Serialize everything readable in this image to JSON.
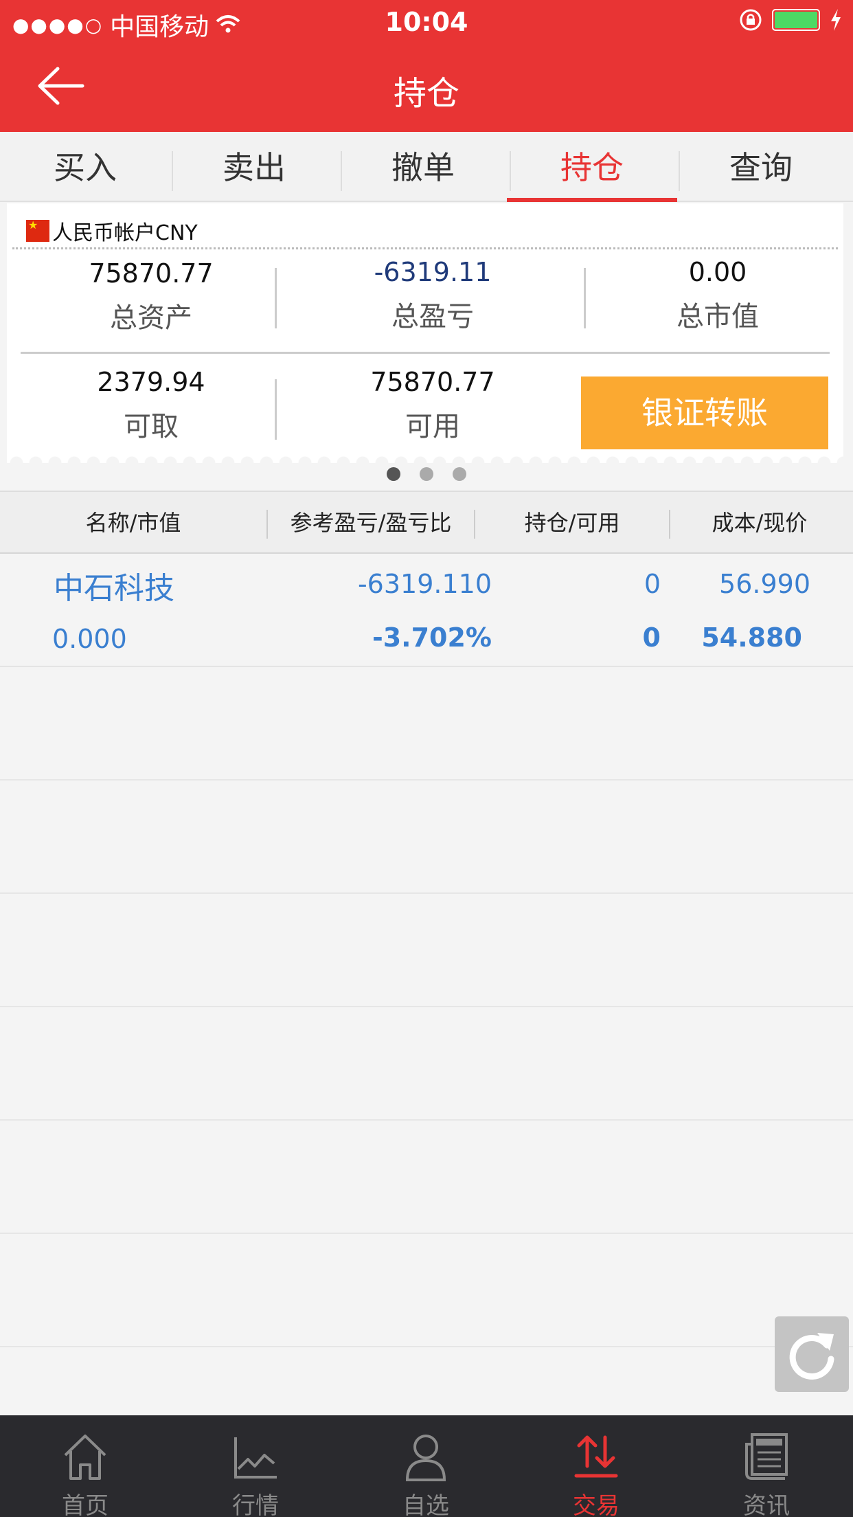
{
  "status_bar": {
    "signal": "●●●●○",
    "carrier": "中国移动",
    "time": "10:04"
  },
  "header": {
    "title": "持仓"
  },
  "tabs": [
    {
      "label": "买入"
    },
    {
      "label": "卖出"
    },
    {
      "label": "撤单"
    },
    {
      "label": "持仓"
    },
    {
      "label": "查询"
    }
  ],
  "account": {
    "name": "人民币帐户CNY",
    "total_assets_value": "75870.77",
    "total_assets_label": "总资产",
    "total_pl_value": "-6319.11",
    "total_pl_label": "总盈亏",
    "market_value_value": "0.00",
    "market_value_label": "总市值",
    "withdrawable_value": "2379.94",
    "withdrawable_label": "可取",
    "available_value": "75870.77",
    "available_label": "可用",
    "transfer_label": "银证转账"
  },
  "table": {
    "headers": [
      "名称/市值",
      "参考盈亏/盈亏比",
      "持仓/可用",
      "成本/现价"
    ],
    "rows": [
      {
        "name": "中石科技",
        "market_value": "0.000",
        "pl": "-6319.110",
        "pl_ratio": "-3.702%",
        "position": "0",
        "available": "0",
        "cost": "56.990",
        "price": "54.880"
      }
    ]
  },
  "bottom_nav": [
    {
      "label": "首页",
      "icon": "home-icon"
    },
    {
      "label": "行情",
      "icon": "chart-icon"
    },
    {
      "label": "自选",
      "icon": "user-icon"
    },
    {
      "label": "交易",
      "icon": "trade-icon"
    },
    {
      "label": "资讯",
      "icon": "news-icon"
    }
  ],
  "colors": {
    "primary": "#e83434",
    "accent": "#fba931",
    "link": "#3a7fd0",
    "navy": "#1f3a7a"
  }
}
